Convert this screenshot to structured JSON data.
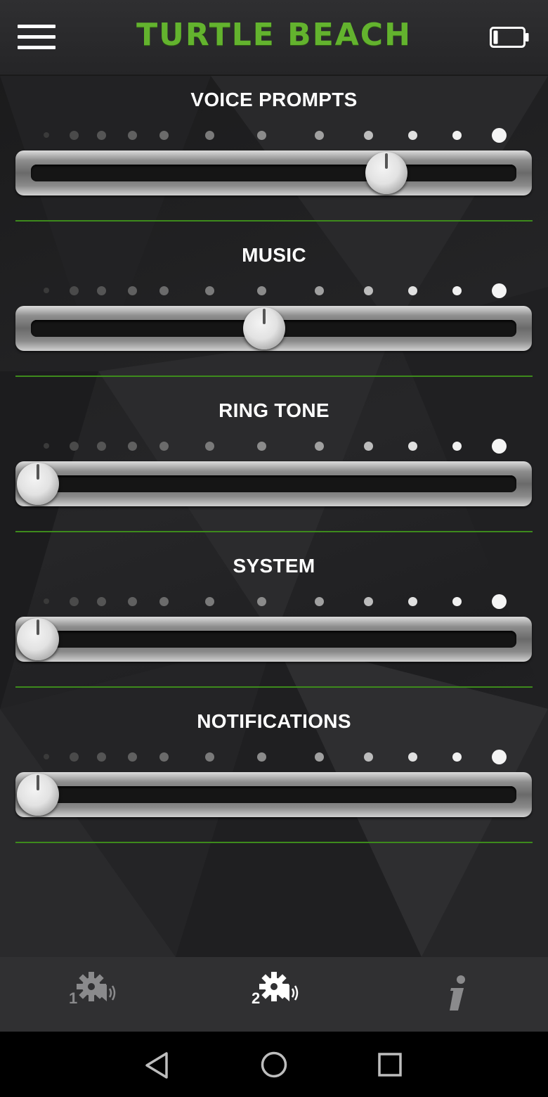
{
  "header": {
    "title": "TURTLE BEACH",
    "menu_icon": "hamburger-menu-icon",
    "battery_icon": "battery-icon",
    "battery_level": 0.15,
    "brand_color": "#63b32e"
  },
  "sliders": [
    {
      "label": "VOICE PROMPTS",
      "value": 0.74
    },
    {
      "label": "MUSIC",
      "value": 0.48
    },
    {
      "label": "RING TONE",
      "value": 0.0
    },
    {
      "label": "SYSTEM",
      "value": 0.0
    },
    {
      "label": "NOTIFICATIONS",
      "value": 0.0
    }
  ],
  "tabs": [
    {
      "number": "1",
      "icon": "settings-speaker-icon",
      "active": false
    },
    {
      "number": "2",
      "icon": "settings-speaker-icon",
      "active": true
    },
    {
      "number": "",
      "icon": "info-icon",
      "active": false
    }
  ],
  "nav": {
    "back_icon": "back-triangle-icon",
    "home_icon": "home-circle-icon",
    "recents_icon": "recents-square-icon"
  },
  "colors": {
    "divider": "#3d8a1c",
    "tab_active": "#ffffff",
    "tab_inactive": "#8a8a8c"
  }
}
